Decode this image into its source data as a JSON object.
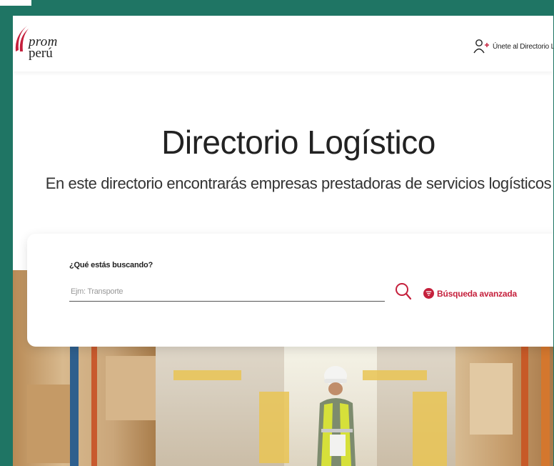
{
  "header": {
    "logo": {
      "line1": "prom",
      "line2": "perú"
    },
    "join_label": "Únete al Directorio Logístico"
  },
  "hero": {
    "title": "Directorio Logístico",
    "subtitle": "En este directorio encontrarás empresas prestadoras de servicios logísticos"
  },
  "search": {
    "label": "¿Qué estás buscando?",
    "placeholder": "Ejm: Transporte",
    "value": "",
    "advanced_label": "Búsqueda avanzada"
  },
  "colors": {
    "frame": "#1f7564",
    "accent": "#c5203c",
    "text": "#222222"
  },
  "icons": {
    "join": "user-plus-icon",
    "search": "search-icon",
    "advanced": "filter-icon"
  }
}
